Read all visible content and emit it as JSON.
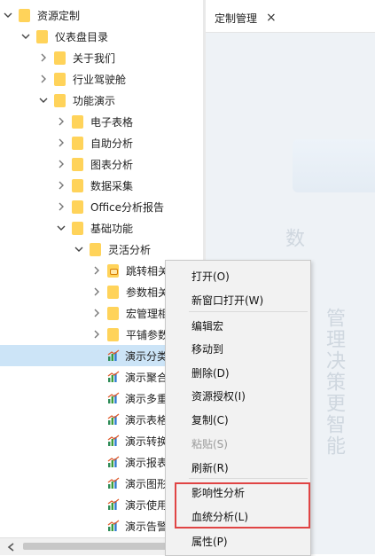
{
  "tree": [
    {
      "label": "资源定制",
      "level": 0,
      "caret": "down",
      "icon": "folder"
    },
    {
      "label": "仪表盘目录",
      "level": 1,
      "caret": "down",
      "icon": "folder"
    },
    {
      "label": "关于我们",
      "level": 2,
      "caret": "right",
      "icon": "folder"
    },
    {
      "label": "行业驾驶舱",
      "level": 2,
      "caret": "right",
      "icon": "folder"
    },
    {
      "label": "功能演示",
      "level": 2,
      "caret": "down",
      "icon": "folder"
    },
    {
      "label": "电子表格",
      "level": 3,
      "caret": "right",
      "icon": "folder"
    },
    {
      "label": "自助分析",
      "level": 3,
      "caret": "right",
      "icon": "folder"
    },
    {
      "label": "图表分析",
      "level": 3,
      "caret": "right",
      "icon": "folder"
    },
    {
      "label": "数据采集",
      "level": 3,
      "caret": "right",
      "icon": "folder"
    },
    {
      "label": "Office分析报告",
      "level": 3,
      "caret": "right",
      "icon": "folder"
    },
    {
      "label": "基础功能",
      "level": 3,
      "caret": "down",
      "icon": "folder"
    },
    {
      "label": "灵活分析",
      "level": 4,
      "caret": "down",
      "icon": "folder"
    },
    {
      "label": "跳转相关",
      "level": 5,
      "caret": "right",
      "icon": "folder-lock"
    },
    {
      "label": "参数相关",
      "level": 5,
      "caret": "right",
      "icon": "folder"
    },
    {
      "label": "宏管理相",
      "level": 5,
      "caret": "right",
      "icon": "folder"
    },
    {
      "label": "平铺参数",
      "level": 5,
      "caret": "right",
      "icon": "folder"
    },
    {
      "label": "演示分类",
      "level": 5,
      "caret": "none",
      "icon": "chart",
      "selected": true
    },
    {
      "label": "演示聚合",
      "level": 5,
      "caret": "none",
      "icon": "chart"
    },
    {
      "label": "演示多重",
      "level": 5,
      "caret": "none",
      "icon": "chart"
    },
    {
      "label": "演示表格",
      "level": 5,
      "caret": "none",
      "icon": "chart"
    },
    {
      "label": "演示转换",
      "level": 5,
      "caret": "none",
      "icon": "chart"
    },
    {
      "label": "演示报表",
      "level": 5,
      "caret": "none",
      "icon": "chart"
    },
    {
      "label": "演示图形",
      "level": 5,
      "caret": "none",
      "icon": "chart"
    },
    {
      "label": "演示使用",
      "level": 5,
      "caret": "none",
      "icon": "chart"
    },
    {
      "label": "演示告警",
      "level": 5,
      "caret": "none",
      "icon": "chart"
    }
  ],
  "tab": {
    "title": "定制管理",
    "close": "×"
  },
  "watermark": {
    "vertical_1": "管理决策更智能",
    "vertical_2": "数"
  },
  "menu": {
    "items": [
      {
        "label": "打开(O)",
        "enabled": true
      },
      {
        "label": "新窗口打开(W)",
        "enabled": true
      },
      {
        "label": "编辑宏",
        "enabled": true
      },
      {
        "label": "移动到",
        "enabled": true
      },
      {
        "label": "删除(D)",
        "enabled": true
      },
      {
        "label": "资源授权(I)",
        "enabled": true
      },
      {
        "label": "复制(C)",
        "enabled": true
      },
      {
        "label": "粘贴(S)",
        "enabled": false
      },
      {
        "label": "刷新(R)",
        "enabled": true
      },
      {
        "label": "影响性分析",
        "enabled": true
      },
      {
        "label": "血统分析(L)",
        "enabled": true
      },
      {
        "label": "属性(P)",
        "enabled": true
      }
    ]
  },
  "colors": {
    "folder": "#ffd35a",
    "selection": "#cce4f7",
    "highlight_box": "#e04444"
  }
}
